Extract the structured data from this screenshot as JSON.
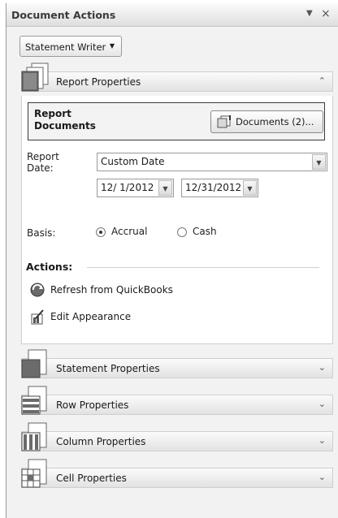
{
  "pane": {
    "title": "Document Actions",
    "menu_glyph": "▼",
    "close_glyph": "×"
  },
  "writer_button": {
    "label": "Statement Writer",
    "caret": "▼"
  },
  "report_properties": {
    "title": "Report Properties",
    "chevron": "⌃",
    "report_documents_label": "Report Documents",
    "documents_button": "Documents (2)...",
    "report_date_label": "Report Date:",
    "report_date_value": "Custom Date",
    "from_date": "12/ 1/2012",
    "to_date": "12/31/2012",
    "basis_label": "Basis:",
    "basis_options": [
      "Accrual",
      "Cash"
    ],
    "basis_selected": "Accrual",
    "actions_title": "Actions:",
    "actions": [
      "Refresh from QuickBooks",
      "Edit Appearance"
    ]
  },
  "groups": [
    {
      "title": "Statement Properties",
      "chevron": "⌄",
      "icon": "statement-doc-icon"
    },
    {
      "title": "Row Properties",
      "chevron": "⌄",
      "icon": "row-doc-icon"
    },
    {
      "title": "Column Properties",
      "chevron": "⌄",
      "icon": "column-doc-icon"
    },
    {
      "title": "Cell Properties",
      "chevron": "⌄",
      "icon": "cell-doc-icon"
    }
  ],
  "colors": {
    "pane_bg": "#f2f2f2",
    "panel_bg": "#ffffff",
    "border": "#9a9a9a"
  }
}
